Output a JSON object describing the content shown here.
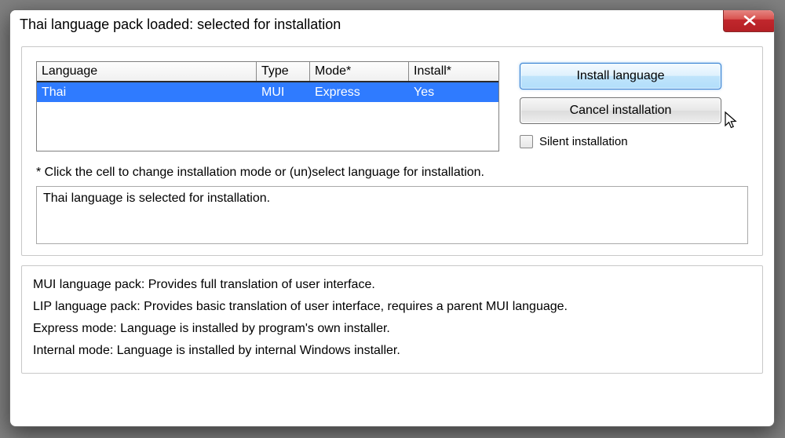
{
  "dialog": {
    "title": "Thai language pack loaded: selected for installation"
  },
  "table": {
    "headers": {
      "language": "Language",
      "type": "Type",
      "mode": "Mode*",
      "install": "Install*"
    },
    "rows": [
      {
        "language": "Thai",
        "type": "MUI",
        "mode": "Express",
        "install": "Yes"
      }
    ]
  },
  "buttons": {
    "install": "Install language",
    "cancel": "Cancel installation"
  },
  "silent_label": "Silent installation",
  "hint": "* Click the cell to change installation mode or (un)select language for installation.",
  "status": "Thai language is selected for installation.",
  "info": {
    "mui": "MUI language pack: Provides full translation of user interface.",
    "lip": "LIP language pack: Provides basic translation of user interface, requires a parent MUI language.",
    "exp": "Express mode: Language is installed by program's own installer.",
    "int": "Internal mode: Language is installed by internal Windows installer."
  }
}
